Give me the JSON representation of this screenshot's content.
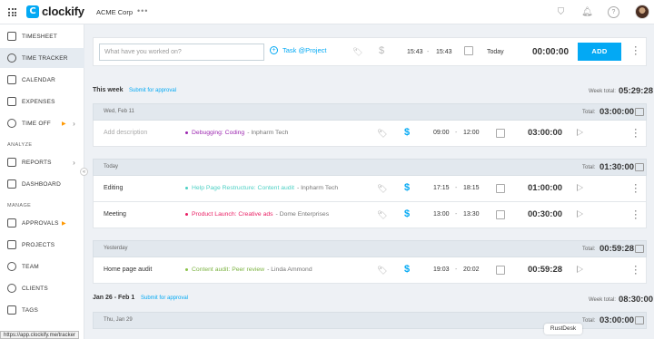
{
  "header": {
    "brand": "clockify",
    "workspace": "ACME Corp",
    "more": "•••",
    "icons": [
      "grid-icon",
      "gift-icon",
      "bell-icon",
      "help-icon",
      "avatar"
    ]
  },
  "sidebar": {
    "items": [
      {
        "label": "TIMESHEET",
        "icon": "timesheet-icon"
      },
      {
        "label": "TIME TRACKER",
        "icon": "clock-icon",
        "active": true
      },
      {
        "label": "CALENDAR",
        "icon": "calendar-icon"
      },
      {
        "label": "EXPENSES",
        "icon": "expenses-icon"
      },
      {
        "label": "TIME OFF",
        "icon": "time-off-icon"
      }
    ],
    "analyze_label": "ANALYZE",
    "analyze_items": [
      {
        "label": "REPORTS",
        "icon": "reports-icon"
      },
      {
        "label": "DASHBOARD",
        "icon": "dashboard-icon"
      }
    ],
    "manage_label": "MANAGE",
    "manage_items": [
      {
        "label": "APPROVALS",
        "icon": "approvals-icon"
      },
      {
        "label": "PROJECTS",
        "icon": "projects-icon"
      },
      {
        "label": "TEAM",
        "icon": "team-icon"
      },
      {
        "label": "CLIENTS",
        "icon": "clients-icon"
      },
      {
        "label": "TAGS",
        "icon": "tags-icon"
      }
    ]
  },
  "status_url": "https://app.clockify.me/tracker",
  "timer": {
    "placeholder": "What have you worked on?",
    "project_label": "Task @Project",
    "start": "15:43",
    "dash": "-",
    "end": "15:43",
    "date": "Today",
    "duration": "00:00:00",
    "add_label": "ADD"
  },
  "weeks": [
    {
      "label": "This week",
      "submit_label": "Submit for approval",
      "total_label": "Week total:",
      "total": "05:29:28"
    },
    {
      "label": "Jan 26 - Feb 1",
      "submit_label": "Submit for approval",
      "total_label": "Week total:",
      "total": "08:30:00"
    }
  ],
  "days": [
    {
      "label": "Wed, Feb 11",
      "total_label": "Total:",
      "total": "03:00:00",
      "entries": [
        {
          "description": "Add description",
          "project": "Debugging: Coding",
          "client": "- Inpharm Tech",
          "project_color": "#9c27b0",
          "start": "09:00",
          "end": "12:00",
          "duration": "03:00:00"
        }
      ]
    },
    {
      "label": "Today",
      "total_label": "Total:",
      "total": "01:30:00",
      "entries": [
        {
          "description": "Editing",
          "project": "Help Page Restructure: Content audit",
          "client": "- Inpharm Tech",
          "project_color": "#4dd0c4",
          "start": "17:15",
          "end": "18:15",
          "duration": "01:00:00"
        },
        {
          "description": "Meeting",
          "project": "Product Launch: Creative ads",
          "client": "- Dome Enterprises",
          "project_color": "#e91e63",
          "start": "13:00",
          "end": "13:30",
          "duration": "00:30:00"
        }
      ]
    },
    {
      "label": "Yesterday",
      "total_label": "Total:",
      "total": "00:59:28",
      "entries": [
        {
          "description": "Home page audit",
          "project": "Content audit: Peer review",
          "client": "- Linda Ammond",
          "project_color": "#8bc34a",
          "start": "19:03",
          "end": "20:02",
          "duration": "00:59:28"
        }
      ]
    },
    {
      "label": "Thu, Jan 29",
      "total_label": "Total:",
      "total": "03:00:00",
      "entries": []
    }
  ],
  "overlay": "RustDesk"
}
